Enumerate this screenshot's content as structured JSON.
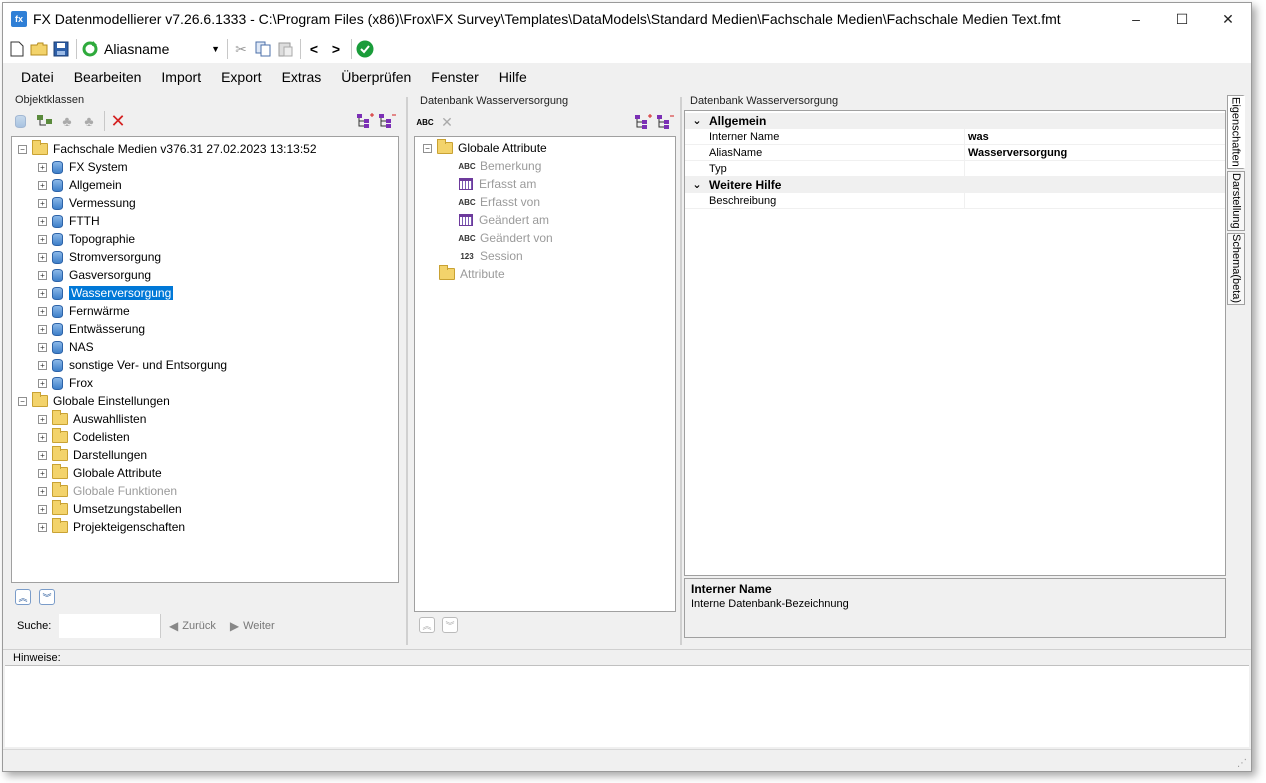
{
  "title": "FX Datenmodellierer v7.26.6.1333 - C:\\Program Files (x86)\\Frox\\FX Survey\\Templates\\DataModels\\Standard Medien\\Fachschale Medien\\Fachschale Medien Text.fmt",
  "app_icon_label": "fx",
  "window_buttons": {
    "minimize": "–",
    "maximize": "☐",
    "close": "✕"
  },
  "toolbar": {
    "alias_value": "Aliasname"
  },
  "menu": [
    "Datei",
    "Bearbeiten",
    "Import",
    "Export",
    "Extras",
    "Überprüfen",
    "Fenster",
    "Hilfe"
  ],
  "left_panel": {
    "title": "Objektklassen",
    "root1": "Fachschale Medien v376.31 27.02.2023 13:13:52",
    "items1": [
      "FX System",
      "Allgemein",
      "Vermessung",
      "FTTH",
      "Topographie",
      "Stromversorgung",
      "Gasversorgung",
      "Wasserversorgung",
      "Fernwärme",
      "Entwässerung",
      "NAS",
      "sonstige Ver- und Entsorgung",
      "Frox"
    ],
    "root2": "Globale Einstellungen",
    "items2": [
      "Auswahllisten",
      "Codelisten",
      "Darstellungen",
      "Globale Attribute",
      "Globale Funktionen",
      "Umsetzungstabellen",
      "Projekteigenschaften"
    ],
    "search_label": "Suche:",
    "back_label": "Zurück",
    "forward_label": "Weiter"
  },
  "mid_panel": {
    "title": "Datenbank Wasserversorgung",
    "group": "Globale Attribute",
    "attrs": [
      {
        "label": "Bemerkung",
        "icon": "ABC"
      },
      {
        "label": "Erfasst am",
        "icon": "cal"
      },
      {
        "label": "Erfasst von",
        "icon": "ABC"
      },
      {
        "label": "Geändert am",
        "icon": "cal"
      },
      {
        "label": "Geändert von",
        "icon": "ABC"
      },
      {
        "label": "Session",
        "icon": "123"
      }
    ],
    "folder2": "Attribute",
    "abc_icon": "ABC",
    "num_icon": "123"
  },
  "right_panel": {
    "title": "Datenbank Wasserversorgung",
    "cat1": "Allgemein",
    "rows1": [
      {
        "name": "Interner Name",
        "value": "was"
      },
      {
        "name": "AliasName",
        "value": "Wasserversorgung"
      },
      {
        "name": "Typ",
        "value": ""
      }
    ],
    "cat2": "Weitere Hilfe",
    "rows2": [
      {
        "name": "Beschreibung",
        "value": ""
      }
    ],
    "help_title": "Interner Name",
    "help_text": "Interne Datenbank-Bezeichnung"
  },
  "side_tabs": [
    "Eigenschaften",
    "Darstellung",
    "Schema(beta)"
  ],
  "hints_label": "Hinweise:"
}
